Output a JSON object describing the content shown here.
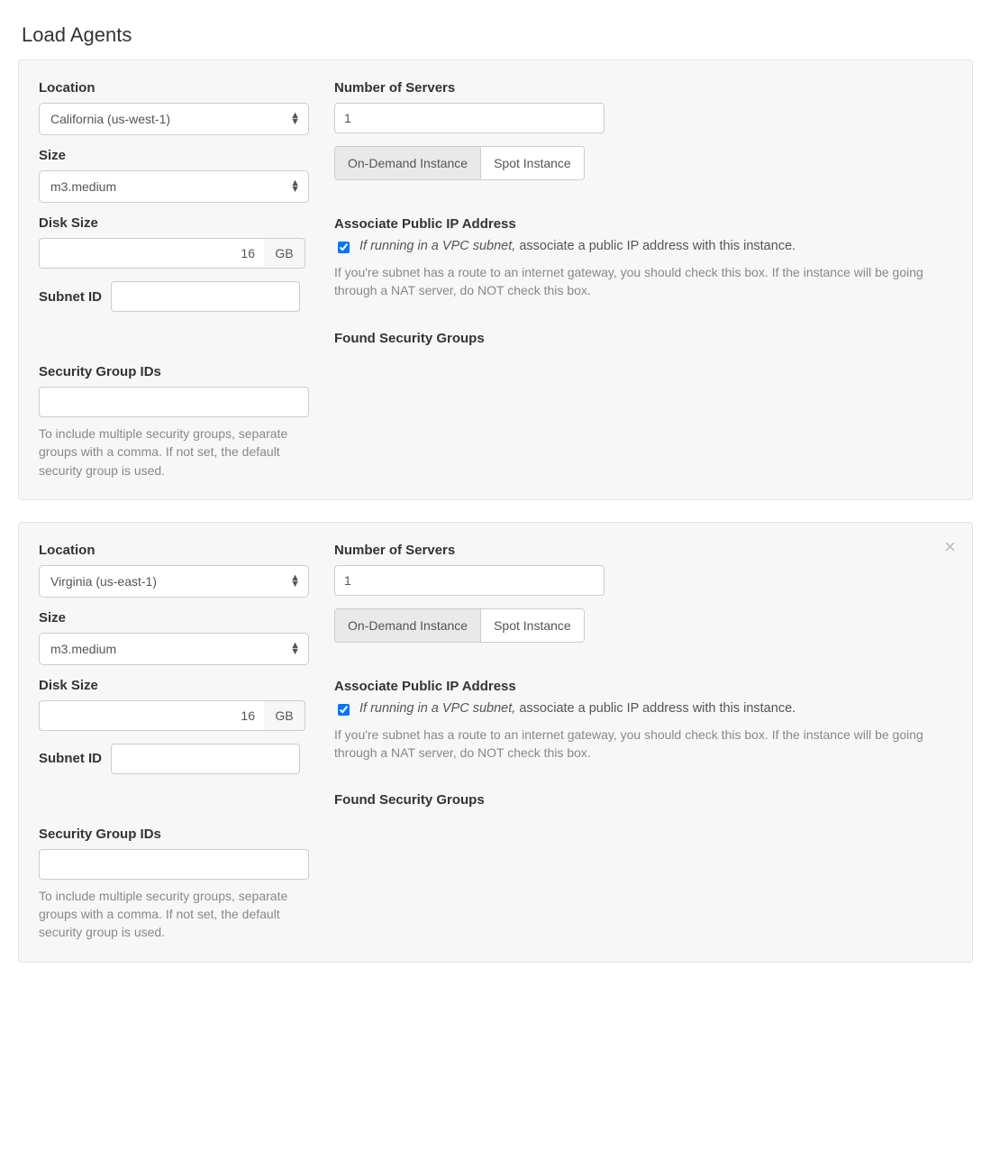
{
  "page": {
    "title": "Load Agents"
  },
  "labels": {
    "location": "Location",
    "size": "Size",
    "disk_size": "Disk Size",
    "disk_unit": "GB",
    "subnet_id": "Subnet ID",
    "security_group_ids": "Security Group IDs",
    "num_servers": "Number of Servers",
    "associate_ip": "Associate Public IP Address",
    "found_sg": "Found Security Groups"
  },
  "help": {
    "sg_note": "To include multiple security groups, separate groups with a comma. If not set, the default security group is used.",
    "vpc_note_em": "If running in a VPC subnet,",
    "vpc_note_rest": " associate a public IP address with this instance.",
    "vpc_help": "If you're subnet has a route to an internet gateway, you should check this box. If the instance will be going through a NAT server, do NOT check this box."
  },
  "instance_buttons": {
    "on_demand": "On-Demand Instance",
    "spot": "Spot Instance"
  },
  "agents": [
    {
      "location": "California (us-west-1)",
      "size": "m3.medium",
      "disk_size": "16",
      "subnet_id": "",
      "security_group_ids": "",
      "num_servers": "1",
      "instance_mode": "on_demand",
      "associate_ip_checked": true,
      "closable": false
    },
    {
      "location": "Virginia (us-east-1)",
      "size": "m3.medium",
      "disk_size": "16",
      "subnet_id": "",
      "security_group_ids": "",
      "num_servers": "1",
      "instance_mode": "on_demand",
      "associate_ip_checked": true,
      "closable": true
    }
  ]
}
